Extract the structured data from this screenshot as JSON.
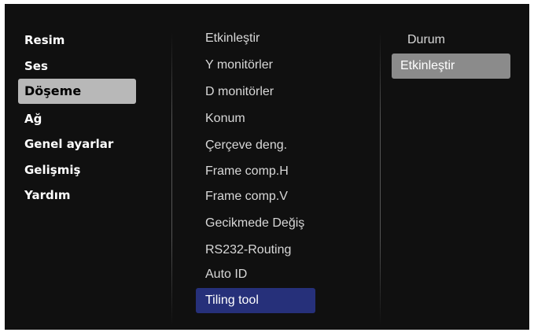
{
  "left_menu": {
    "items": [
      "Resim",
      "Ses",
      "Döşeme",
      "Ağ",
      "Genel ayarlar",
      "Gelişmiş",
      "Yardım"
    ],
    "selected_index": 2
  },
  "middle_menu": {
    "items": [
      "Etkinleştir",
      "Y monitörler",
      "D monitörler",
      "Konum",
      "Çerçeve deng.",
      "Frame comp.H",
      "Frame comp.V",
      "Gecikmede Değiş",
      "RS232-Routing",
      "Auto ID",
      "Tiling tool"
    ],
    "highlighted_index": 10
  },
  "right_menu": {
    "items": [
      "Durum",
      "Etkinleştir"
    ],
    "selected_index": 1
  },
  "colors": {
    "screen_bg": "#101010",
    "left_selected_bg": "#b8b8b8",
    "middle_highlight_bg": "#26307a",
    "right_selected_bg": "#8b8b8b",
    "text": "#ffffff"
  }
}
